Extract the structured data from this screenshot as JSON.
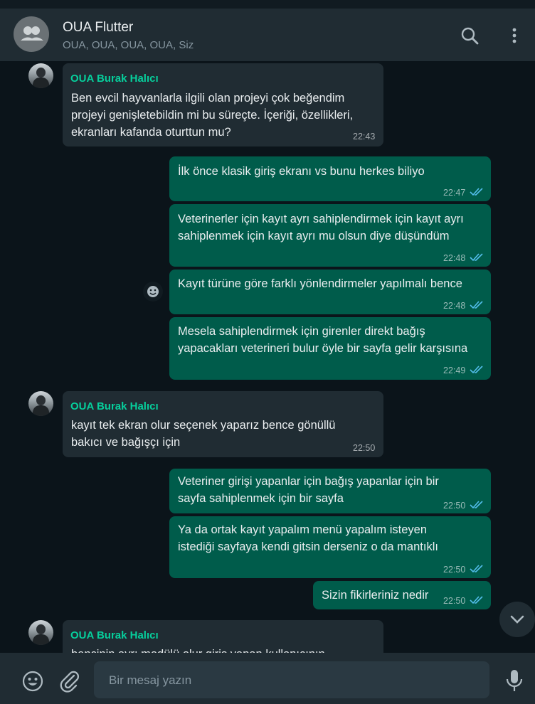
{
  "header": {
    "title": "OUA Flutter",
    "subtitle": "OUA, OUA, OUA, OUA, Siz"
  },
  "messages": [
    {
      "sender": "OUA Burak Halıcı",
      "text": "Ben evcil hayvanlarla ilgili olan projeyi çok beğendim\nprojeyi genişletebildin mi bu süreçte. İçeriği, özellikleri,\nekranları kafanda oturttun mu?",
      "time": "22:43"
    },
    {
      "text": "İlk önce klasik giriş ekranı vs bunu herkes biliyo",
      "time": "22:47"
    },
    {
      "text": "Veterinerler için kayıt ayrı sahiplendirmek için kayıt ayrı\nsahiplenmek için kayıt ayrı mu olsun diye düşündüm",
      "time": "22:48"
    },
    {
      "text": "Kayıt türüne göre farklı yönlendirmeler yapılmalı bence",
      "time": "22:48"
    },
    {
      "text": "Mesela sahiplendirmek için girenler direkt bağış\nyapacakları veterineri bulur öyle bir sayfa gelir karşısına",
      "time": "22:49"
    },
    {
      "sender": "OUA Burak Halıcı",
      "text": "kayıt tek ekran olur seçenek yaparız bence gönüllü\nbakıcı ve bağışçı için",
      "time": "22:50"
    },
    {
      "text": "Veteriner girişi yapanlar için bağış yapanlar için bir\nsayfa sahiplenmek için bir sayfa",
      "time": "22:50"
    },
    {
      "text": "Ya da ortak kayıt yapalım menü yapalım isteyen\nistediği sayfaya kendi gitsin derseniz o da mantıklı",
      "time": "22:50"
    },
    {
      "text": "Sizin fikirleriniz nedir",
      "time": "22:50"
    },
    {
      "sender": "OUA Burak Halıcı",
      "text": "bencinin ayrı modülü olur giriş yapan kullanıcının",
      "time": ""
    }
  ],
  "composer": {
    "placeholder": "Bir mesaj yazın"
  },
  "icons": {
    "header_search": "search-icon",
    "header_menu": "menu-icon",
    "emoji": "emoji-icon",
    "attach": "paperclip-icon",
    "mic": "microphone-icon",
    "scroll": "chevron-down-icon",
    "read_receipt": "double-check-icon"
  },
  "colors": {
    "incoming_bubble": "#202c33",
    "outgoing_bubble": "#005c4b",
    "sender_name": "#06cf9c",
    "read_tick": "#53bdeb"
  }
}
